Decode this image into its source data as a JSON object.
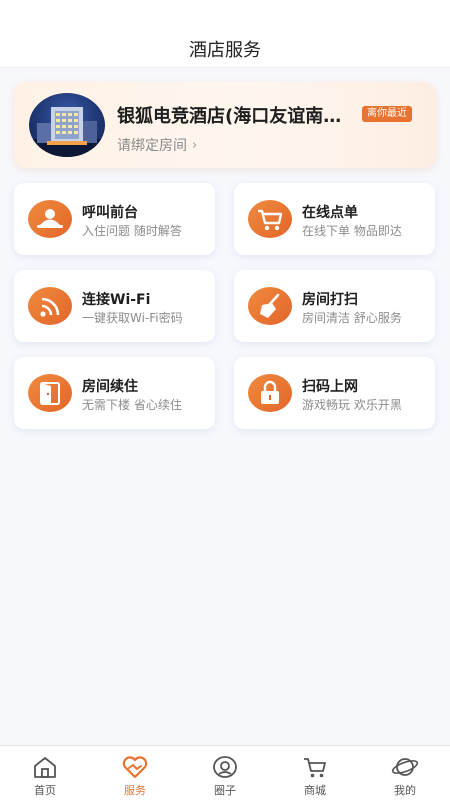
{
  "header": {
    "title": "酒店服务"
  },
  "hotel": {
    "name": "银狐电竞酒店(海口友谊南亚店)",
    "badge": "离你最近",
    "bind_room": "请绑定房间"
  },
  "services": [
    {
      "title": "呼叫前台",
      "subtitle": "入住问题 随时解答",
      "icon": "front-desk-icon"
    },
    {
      "title": "在线点单",
      "subtitle": "在线下单 物品即达",
      "icon": "shopping-cart-icon"
    },
    {
      "title": "连接Wi-Fi",
      "subtitle": "一键获取Wi-Fi密码",
      "icon": "wifi-icon"
    },
    {
      "title": "房间打扫",
      "subtitle": "房间清洁 舒心服务",
      "icon": "broom-icon"
    },
    {
      "title": "房间续住",
      "subtitle": "无需下楼 省心续住",
      "icon": "door-icon"
    },
    {
      "title": "扫码上网",
      "subtitle": "游戏畅玩 欢乐开黑",
      "icon": "lock-icon"
    }
  ],
  "tabs": [
    {
      "label": "首页",
      "icon": "home-icon"
    },
    {
      "label": "服务",
      "icon": "service-heart-icon",
      "active": true
    },
    {
      "label": "圈子",
      "icon": "circle-eye-icon"
    },
    {
      "label": "商城",
      "icon": "cart-icon"
    },
    {
      "label": "我的",
      "icon": "planet-icon"
    }
  ],
  "colors": {
    "accent": "#e8722f",
    "background": "#f7f8fc"
  }
}
